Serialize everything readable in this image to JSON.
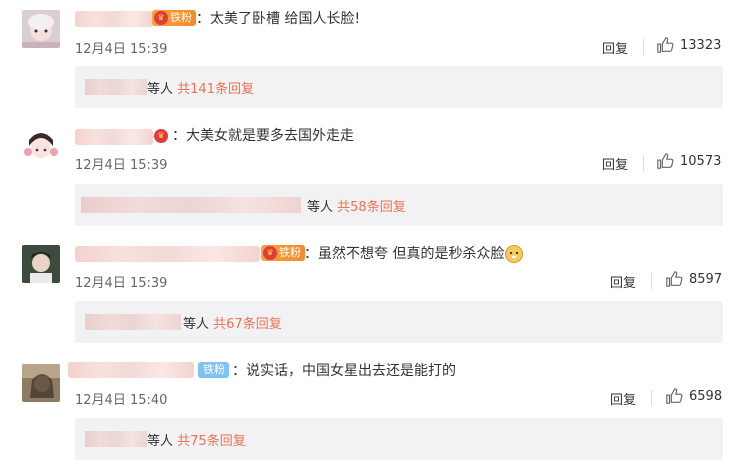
{
  "comments": [
    {
      "badge": "铁粉",
      "text": "太美了卧槽 给国人长脸!",
      "time": "12月4日 15:39",
      "reply": "回复",
      "likes": "13323",
      "sub_prefix": "等人",
      "sub_link": "共141条回复"
    },
    {
      "badge": "",
      "text": "大美女就是要多去国外走走",
      "time": "12月4日 15:39",
      "reply": "回复",
      "likes": "10573",
      "sub_prefix": "等人",
      "sub_link": "共58条回复"
    },
    {
      "badge": "铁粉",
      "text": "虽然不想夸  但真的是秒杀众脸",
      "time": "12月4日 15:39",
      "reply": "回复",
      "likes": "8597",
      "sub_prefix": "等人",
      "sub_link": "共67条回复"
    },
    {
      "badge": "铁粉",
      "text": "说实话，中国女星出去还是能打的",
      "time": "12月4日 15:40",
      "reply": "回复",
      "likes": "6598",
      "sub_prefix": "等人",
      "sub_link": "共75条回复"
    }
  ],
  "icons": {
    "like": "thumbs-up-icon",
    "emoji": "doge-emoji-icon",
    "badge_crown": "crown-icon"
  },
  "colors": {
    "link": "#eb7350",
    "badge_fire": "#f38a2a",
    "badge_blue": "#7ec3f2",
    "sub_bg": "#f2f2f5"
  }
}
